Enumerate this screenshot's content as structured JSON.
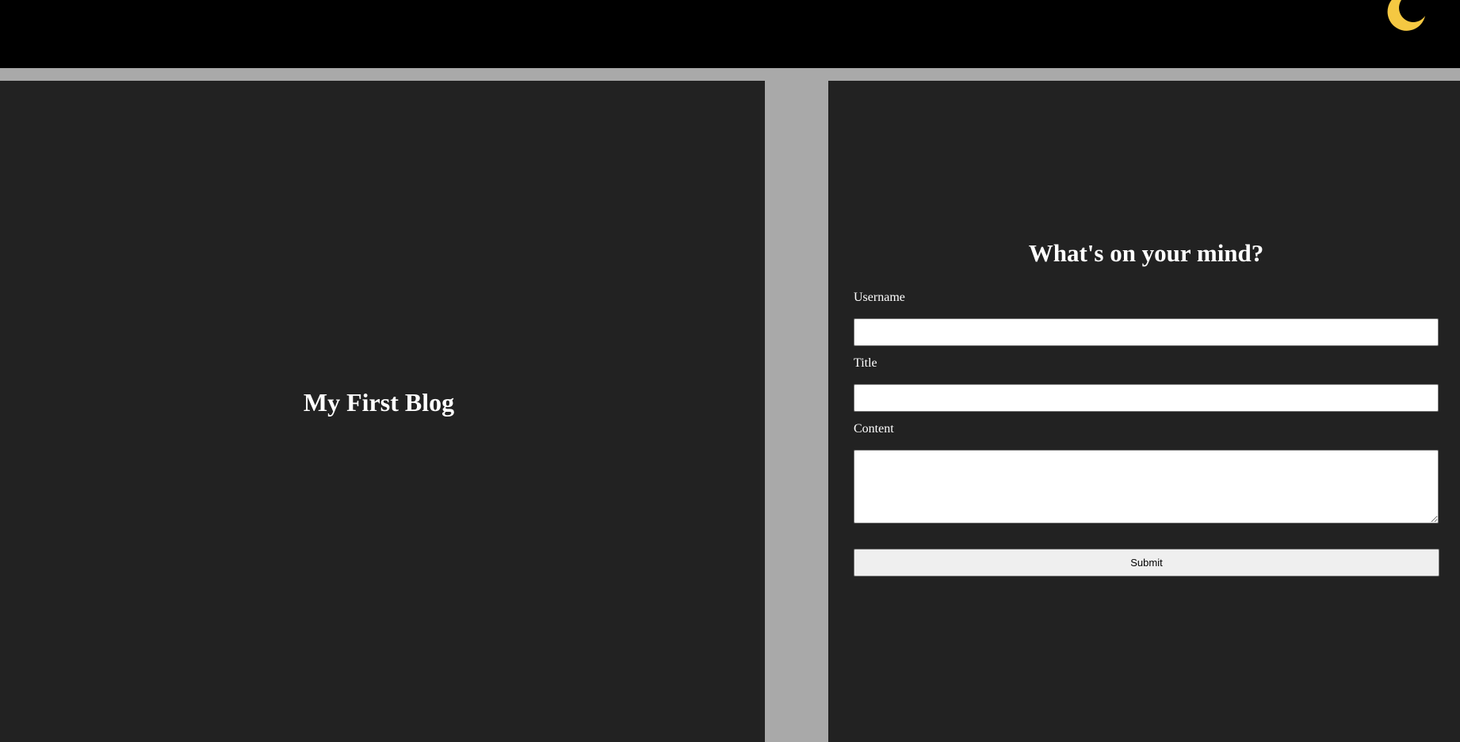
{
  "header": {
    "theme_toggle_icon": "crescent-moon-icon",
    "background_color": "#000000",
    "moon_color": "#f5c842"
  },
  "blog": {
    "title": "My First Blog"
  },
  "form": {
    "heading": "What's on your mind?",
    "username_label": "Username",
    "username_value": "",
    "title_label": "Title",
    "title_value": "",
    "content_label": "Content",
    "content_value": "",
    "submit_label": "Submit"
  },
  "colors": {
    "page_background": "#a9a9a9",
    "panel_background": "#222222",
    "text": "#ffffff"
  }
}
